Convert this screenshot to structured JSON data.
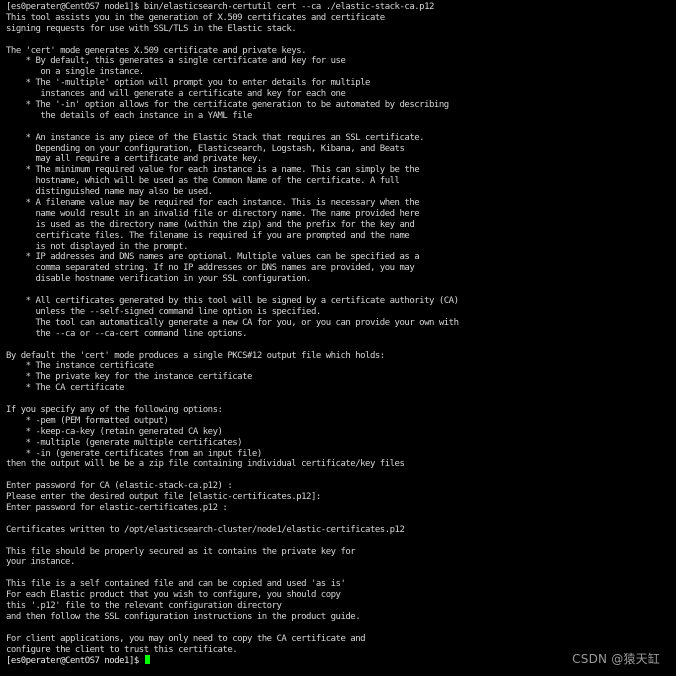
{
  "terminal": {
    "lines": [
      "[es0perater@CentOS7 node1]$ bin/elasticsearch-certutil cert --ca ./elastic-stack-ca.p12",
      "This tool assists you in the generation of X.509 certificates and certificate",
      "signing requests for use with SSL/TLS in the Elastic stack.",
      "",
      "The 'cert' mode generates X.509 certificate and private keys.",
      "    * By default, this generates a single certificate and key for use",
      "       on a single instance.",
      "    * The '-multiple' option will prompt you to enter details for multiple",
      "       instances and will generate a certificate and key for each one",
      "    * The '-in' option allows for the certificate generation to be automated by describing",
      "       the details of each instance in a YAML file",
      "",
      "    * An instance is any piece of the Elastic Stack that requires an SSL certificate.",
      "      Depending on your configuration, Elasticsearch, Logstash, Kibana, and Beats",
      "      may all require a certificate and private key.",
      "    * The minimum required value for each instance is a name. This can simply be the",
      "      hostname, which will be used as the Common Name of the certificate. A full",
      "      distinguished name may also be used.",
      "    * A filename value may be required for each instance. This is necessary when the",
      "      name would result in an invalid file or directory name. The name provided here",
      "      is used as the directory name (within the zip) and the prefix for the key and",
      "      certificate files. The filename is required if you are prompted and the name",
      "      is not displayed in the prompt.",
      "    * IP addresses and DNS names are optional. Multiple values can be specified as a",
      "      comma separated string. If no IP addresses or DNS names are provided, you may",
      "      disable hostname verification in your SSL configuration.",
      "",
      "    * All certificates generated by this tool will be signed by a certificate authority (CA)",
      "      unless the --self-signed command line option is specified.",
      "      The tool can automatically generate a new CA for you, or you can provide your own with",
      "      the --ca or --ca-cert command line options.",
      "",
      "By default the 'cert' mode produces a single PKCS#12 output file which holds:",
      "    * The instance certificate",
      "    * The private key for the instance certificate",
      "    * The CA certificate",
      "",
      "If you specify any of the following options:",
      "    * -pem (PEM formatted output)",
      "    * -keep-ca-key (retain generated CA key)",
      "    * -multiple (generate multiple certificates)",
      "    * -in (generate certificates from an input file)",
      "then the output will be be a zip file containing individual certificate/key files",
      "",
      "Enter password for CA (elastic-stack-ca.p12) :",
      "Please enter the desired output file [elastic-certificates.p12]:",
      "Enter password for elastic-certificates.p12 :",
      "",
      "Certificates written to /opt/elasticsearch-cluster/node1/elastic-certificates.p12",
      "",
      "This file should be properly secured as it contains the private key for",
      "your instance.",
      "",
      "This file is a self contained file and can be copied and used 'as is'",
      "For each Elastic product that you wish to configure, you should copy",
      "this '.p12' file to the relevant configuration directory",
      "and then follow the SSL configuration instructions in the product guide.",
      "",
      "For client applications, you may only need to copy the CA certificate and",
      "configure the client to trust this certificate."
    ],
    "prompt": "[es0perater@CentOS7 node1]$ "
  },
  "watermark": "CSDN @猿天缸",
  "colors": {
    "background": "#000000",
    "text": "#d6d6d6",
    "cursor": "#00ff00",
    "watermark": "#9a9a9a"
  },
  "icons": {
    "cursor": "block-cursor"
  }
}
